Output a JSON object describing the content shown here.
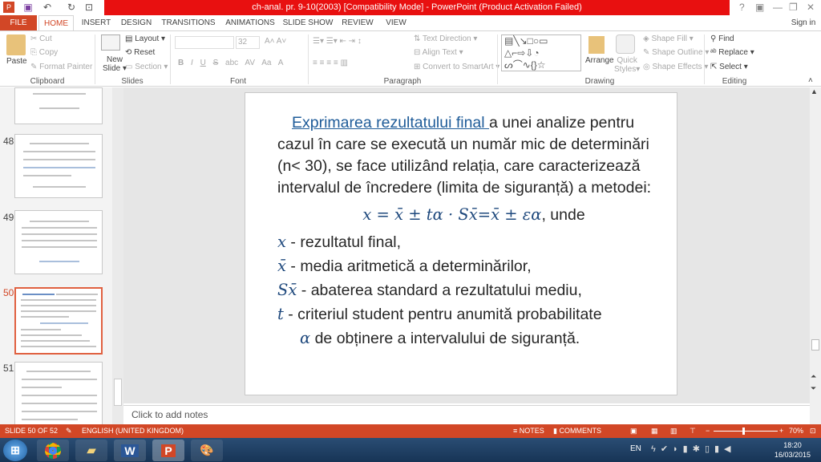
{
  "window": {
    "title": "ch-anal. pr. 9-10(2003) [Compatibility Mode] - PowerPoint (Product Activation Failed)",
    "help": "?",
    "minimize": "—",
    "restore": "❐",
    "close": "✕",
    "sign_in": "Sign in"
  },
  "tabs": [
    "FILE",
    "HOME",
    "INSERT",
    "DESIGN",
    "TRANSITIONS",
    "ANIMATIONS",
    "SLIDE SHOW",
    "REVIEW",
    "VIEW"
  ],
  "ribbon": {
    "clipboard": {
      "paste": "Paste",
      "cut": "Cut",
      "copy": "Copy",
      "format_painter": "Format Painter",
      "label": "Clipboard"
    },
    "slides": {
      "new_slide": "New",
      "new_slide2": "Slide",
      "layout": "Layout",
      "reset": "Reset",
      "section": "Section",
      "label": "Slides"
    },
    "font": {
      "size": "32",
      "label": "Font",
      "bold": "B",
      "italic": "I",
      "underline": "U",
      "strike": "S",
      "abc": "abc",
      "spacing": "AV",
      "case": "Aa",
      "color": "A"
    },
    "paragraph": {
      "text_direction": "Text Direction",
      "align_text": "Align Text",
      "smartart": "Convert to SmartArt",
      "label": "Paragraph"
    },
    "drawing": {
      "arrange": "Arrange",
      "quick_styles": "Quick",
      "quick_styles2": "Styles",
      "shape_fill": "Shape Fill",
      "shape_outline": "Shape Outline",
      "shape_effects": "Shape Effects",
      "label": "Drawing"
    },
    "editing": {
      "find": "Find",
      "replace": "Replace",
      "select": "Select",
      "label": "Editing"
    }
  },
  "thumbnails": [
    {
      "num": "48"
    },
    {
      "num": "49"
    },
    {
      "num": "50",
      "selected": true
    },
    {
      "num": "51"
    }
  ],
  "slide": {
    "link_text": "Exprimarea rezultatului final ",
    "para_rest": "a unei analize pentru cazul în care se execută un număr mic de determinări (n< 30), se face utilizând relația, care caracterizează intervalul de încredere (limita de siguranță) a metodei:",
    "formula": "x = x̄ ± tα · Sx̄=x̄ ± εα",
    "formula_suffix": ", unde",
    "defs": [
      {
        "sym": "x",
        "text": " - rezultatul final,"
      },
      {
        "sym": "x̄",
        "text": " - media aritmetică a determinărilor,"
      },
      {
        "sym": "Sx̄",
        "text": " - abaterea standard a rezultatului mediu,"
      },
      {
        "sym": "t",
        "text": " - criteriul student pentru anumită probabilitate"
      },
      {
        "sym": "α",
        "text": " de obținere a intervalului de siguranță."
      }
    ]
  },
  "notes_placeholder": "Click to add notes",
  "status": {
    "slide": "SLIDE 50 OF 52",
    "language": "ENGLISH (UNITED KINGDOM)",
    "notes": "NOTES",
    "comments": "COMMENTS",
    "zoom": "70%"
  },
  "taskbar": {
    "lang": "EN",
    "time": "18:20",
    "date": "16/03/2015"
  },
  "colors": {
    "accent": "#d24726",
    "title_bar": "#e81010",
    "math": "#1f497d"
  }
}
